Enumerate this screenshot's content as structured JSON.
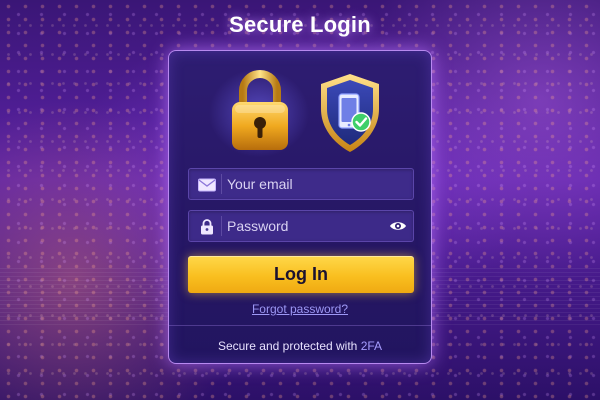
{
  "page": {
    "title": "Secure Login"
  },
  "icons": {
    "lock": "padlock-icon",
    "shield": "shield-phone-check-icon",
    "email": "envelope-icon",
    "password": "padlock-small-icon",
    "toggle_visibility": "eye-icon"
  },
  "form": {
    "email_placeholder": "Your email",
    "email_value": "",
    "password_placeholder": "Password",
    "password_value": "",
    "login_label": "Log In",
    "forgot_label": "Forgot password?"
  },
  "footer": {
    "text": "Secure and protected with",
    "badge": "2FA"
  },
  "colors": {
    "accent": "#f9bf1f",
    "card_border": "#c896ff",
    "link": "#9d98f5",
    "background": "#5b22a6"
  }
}
